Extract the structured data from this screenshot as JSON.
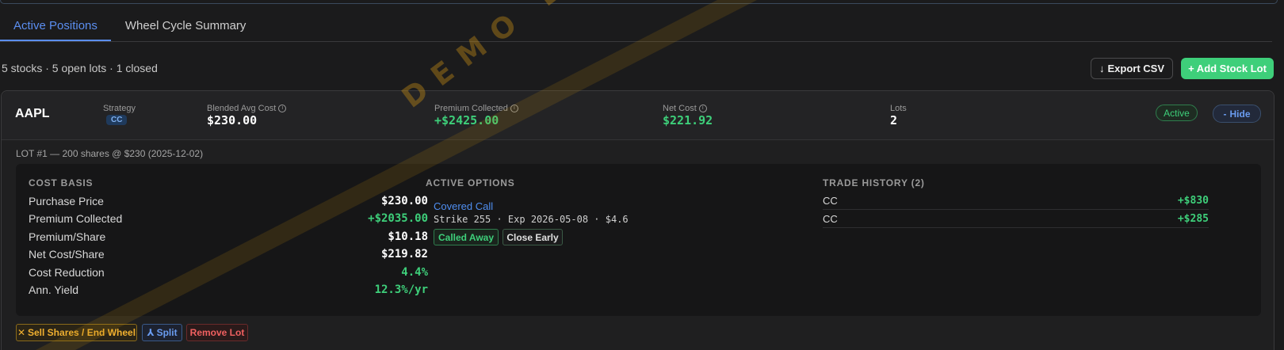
{
  "tabs": [
    {
      "label": "Active Positions"
    },
    {
      "label": "Wheel Cycle Summary"
    }
  ],
  "summary": "5 stocks · 5 open lots · 1 closed",
  "toolbar": {
    "export_label": "Export CSV",
    "add_label": "+ Add Stock Lot"
  },
  "position": {
    "ticker": "AAPL",
    "strategy_label": "Strategy",
    "strategy_value": "CC",
    "blended_label": "Blended Avg Cost",
    "blended_value": "$230.00",
    "premium_label": "Premium Collected",
    "premium_value": "+$2425.00",
    "netcost_label": "Net Cost",
    "netcost_value": "$221.92",
    "lots_label": "Lots",
    "lots_value": "2",
    "status": "Active",
    "hide_label": "Hide"
  },
  "lot": {
    "title": "LOT #1 — 200 shares @ $230 (2025-12-02)",
    "cost_basis": {
      "title": "COST BASIS",
      "rows": [
        {
          "label": "Purchase Price",
          "value": "$230.00"
        },
        {
          "label": "Premium Collected",
          "value": "+$2035.00"
        },
        {
          "label": "Premium/Share",
          "value": "$10.18"
        },
        {
          "label": "Net Cost/Share",
          "value": "$219.82"
        },
        {
          "label": "Cost Reduction",
          "value": "4.4%"
        },
        {
          "label": "Ann. Yield",
          "value": "12.3%/yr"
        }
      ]
    },
    "active_options": {
      "title": "ACTIVE OPTIONS",
      "type": "Covered Call",
      "detail": "Strike 255 · Exp 2026-05-08 · $4.6",
      "called_away_label": "Called Away",
      "close_early_label": "Close Early"
    },
    "trade_history": {
      "title": "TRADE HISTORY (2)",
      "rows": [
        {
          "type": "CC",
          "amount": "+$830"
        },
        {
          "type": "CC",
          "amount": "+$285"
        }
      ]
    },
    "actions": {
      "sell_label": "Sell Shares / End Wheel",
      "split_label": "Split",
      "remove_label": "Remove Lot"
    }
  },
  "watermark": "DEMO DATA",
  "colors": {
    "accent_blue": "#5b8ef0",
    "positive_green": "#3ecf7a",
    "warning_orange": "#f0b030",
    "danger_red": "#f06060"
  }
}
